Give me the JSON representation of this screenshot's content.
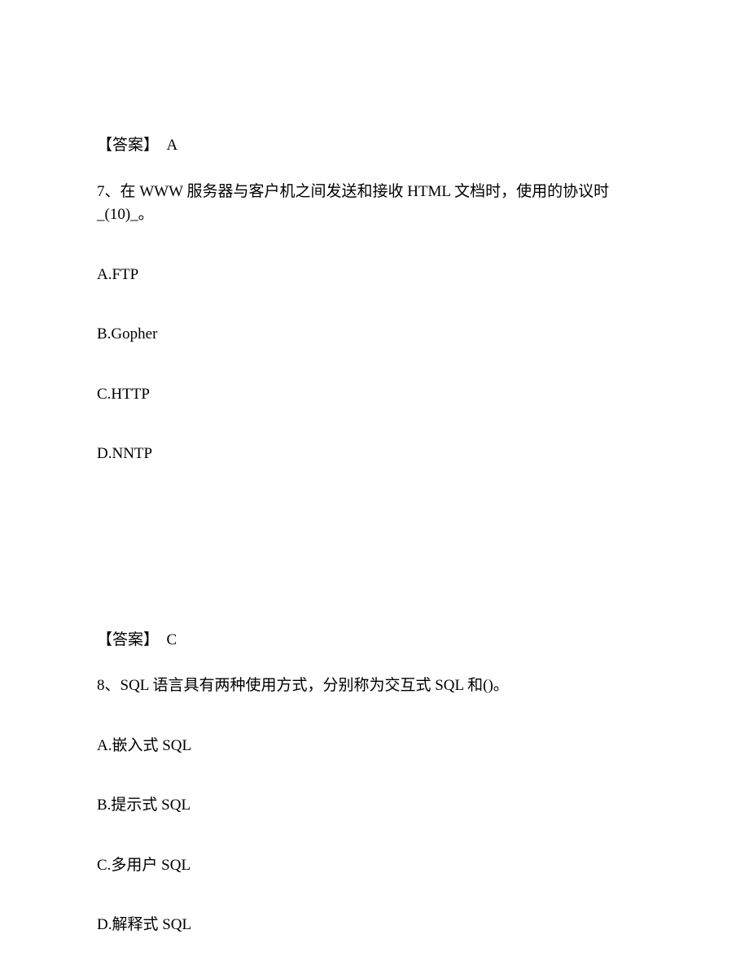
{
  "answer6": {
    "label": "【答案】",
    "value": "A"
  },
  "q7": {
    "stem": "7、在 WWW 服务器与客户机之间发送和接收 HTML 文档时，使用的协议时_(10)_。",
    "options": {
      "A": "A.FTP",
      "B": "B.Gopher",
      "C": "C.HTTP",
      "D": "D.NNTP"
    }
  },
  "answer7": {
    "label": "【答案】",
    "value": "C"
  },
  "q8": {
    "stem": "8、SQL 语言具有两种使用方式，分别称为交互式 SQL 和()。",
    "options": {
      "A": "A.嵌入式 SQL",
      "B": "B.提示式 SQL",
      "C": "C.多用户 SQL",
      "D": "D.解释式 SQL"
    }
  }
}
